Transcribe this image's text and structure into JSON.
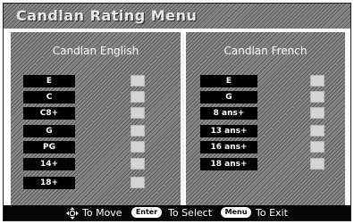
{
  "menu": {
    "title": "Candlan Rating Menu"
  },
  "english": {
    "header": "Candlan English",
    "ratings": [
      "E",
      "C",
      "C8+",
      "G",
      "PG",
      "14+",
      "18+"
    ]
  },
  "french": {
    "header": "Candlan French",
    "ratings": [
      "E",
      "G",
      "8 ans+",
      "13 ans+",
      "16 ans+",
      "18 ans+"
    ]
  },
  "footer": {
    "move_label": "To Move",
    "enter_key": "Enter",
    "select_label": "To Select",
    "menu_key": "Menu",
    "exit_label": "To Exit"
  },
  "icons": {
    "navigation": "dpad-arrows-icon"
  }
}
